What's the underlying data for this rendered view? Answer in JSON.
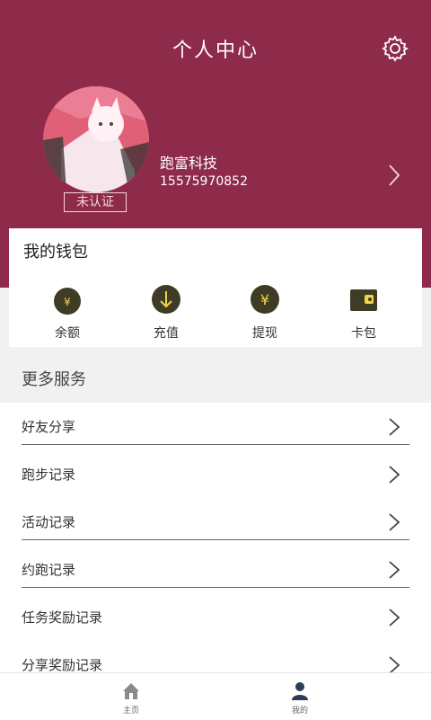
{
  "header": {
    "title": "个人中心"
  },
  "profile": {
    "badge": "未认证",
    "company": "跑富科技",
    "phone": "15575970852"
  },
  "wallet": {
    "title": "我的钱包",
    "items": [
      {
        "label": "余额",
        "icon": "money-bag-icon"
      },
      {
        "label": "充值",
        "icon": "download-circle-icon"
      },
      {
        "label": "提现",
        "icon": "yen-circle-icon"
      },
      {
        "label": "卡包",
        "icon": "wallet-icon"
      }
    ]
  },
  "services": {
    "title": "更多服务",
    "items": [
      {
        "label": "好友分享"
      },
      {
        "label": "跑步记录"
      },
      {
        "label": "活动记录"
      },
      {
        "label": "约跑记录"
      },
      {
        "label": "任务奖励记录"
      },
      {
        "label": "分享奖励记录"
      }
    ]
  },
  "nav": {
    "items": [
      {
        "label": "主页",
        "icon": "home-icon"
      },
      {
        "label": "我的",
        "icon": "person-icon"
      }
    ]
  },
  "colors": {
    "header": "#8e2a4a",
    "icon_dark": "#3f3c26",
    "icon_accent": "#f4d34a",
    "nav_active": "#2f3b56"
  }
}
